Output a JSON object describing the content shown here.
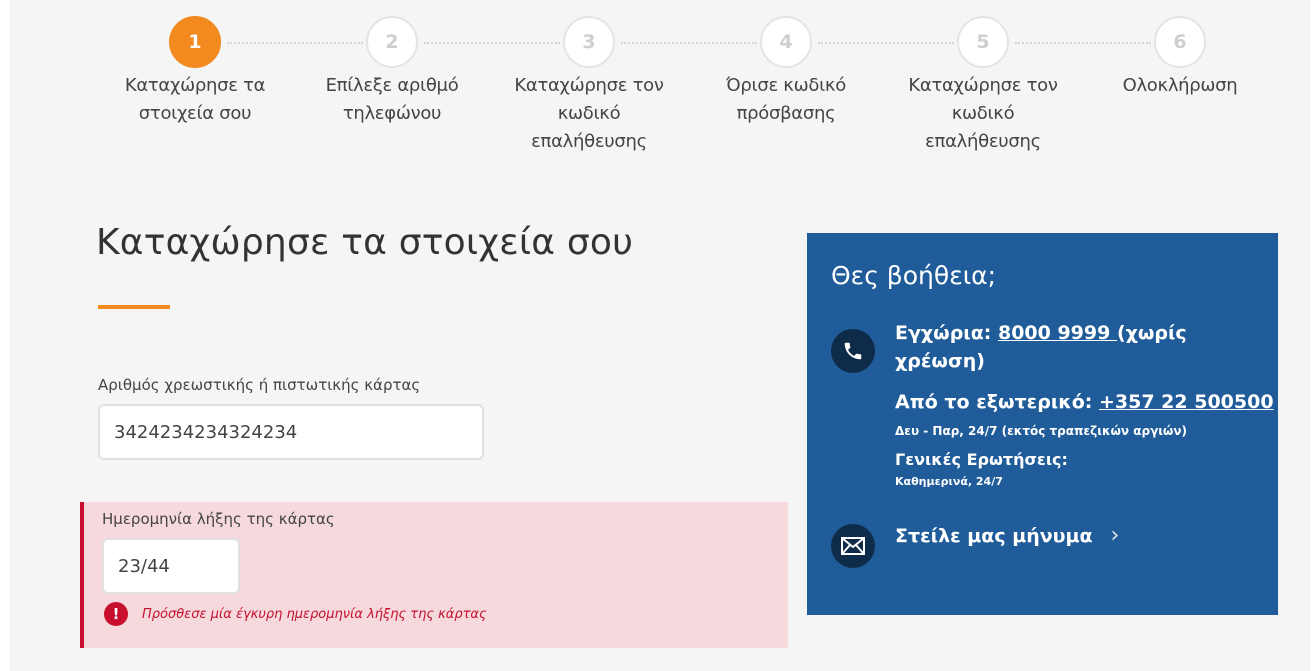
{
  "stepper": {
    "steps": [
      {
        "number": "1",
        "label": "Καταχώρησε τα\nστοιχεία σου",
        "active": true
      },
      {
        "number": "2",
        "label": "Επίλεξε αριθμό\nτηλεφώνου",
        "active": false
      },
      {
        "number": "3",
        "label": "Καταχώρησε τον\nκωδικό\nεπαλήθευσης",
        "active": false
      },
      {
        "number": "4",
        "label": "Όρισε κωδικό\nπρόσβασης",
        "active": false
      },
      {
        "number": "5",
        "label": "Καταχώρησε τον\nκωδικό\nεπαλήθευσης",
        "active": false
      },
      {
        "number": "6",
        "label": "Ολοκλήρωση",
        "active": false
      }
    ]
  },
  "form": {
    "title": "Καταχώρησε τα στοιχεία σου",
    "card_number_label": "Αριθμός χρεωστικής ή πιστωτικής κάρτας",
    "card_number_value": "3424234234324234",
    "expiry_label": "Ημερομηνία λήξης της κάρτας",
    "expiry_value": "23/44",
    "expiry_error": "Πρόσθεσε μία έγκυρη ημερομηνία λήξης της κάρτας",
    "error_icon": "!"
  },
  "help": {
    "title": "Θες βοήθεια;",
    "local_prefix": "Εγχώρια: ",
    "local_number": "8000 9999 ",
    "local_suffix": "(χωρίς χρέωση)",
    "abroad_prefix": "Από το εξωτερικό: ",
    "abroad_number": "+357 22 500500",
    "hours": "Δευ - Παρ, 24/7 (εκτός τραπεζικών αργιών)",
    "faq_label": "Γενικές Ερωτήσεις:",
    "faq_hours": "Καθημερινά, 24/7",
    "message_link": "Στείλε μας μήνυμα",
    "chevron": "›",
    "phone_icon": "phone-icon",
    "mail_icon": "envelope-icon"
  },
  "colors": {
    "accent": "#f38a1f",
    "help_bg": "#1f5c99",
    "error": "#c8102e",
    "error_bg": "#f5d9dd"
  }
}
